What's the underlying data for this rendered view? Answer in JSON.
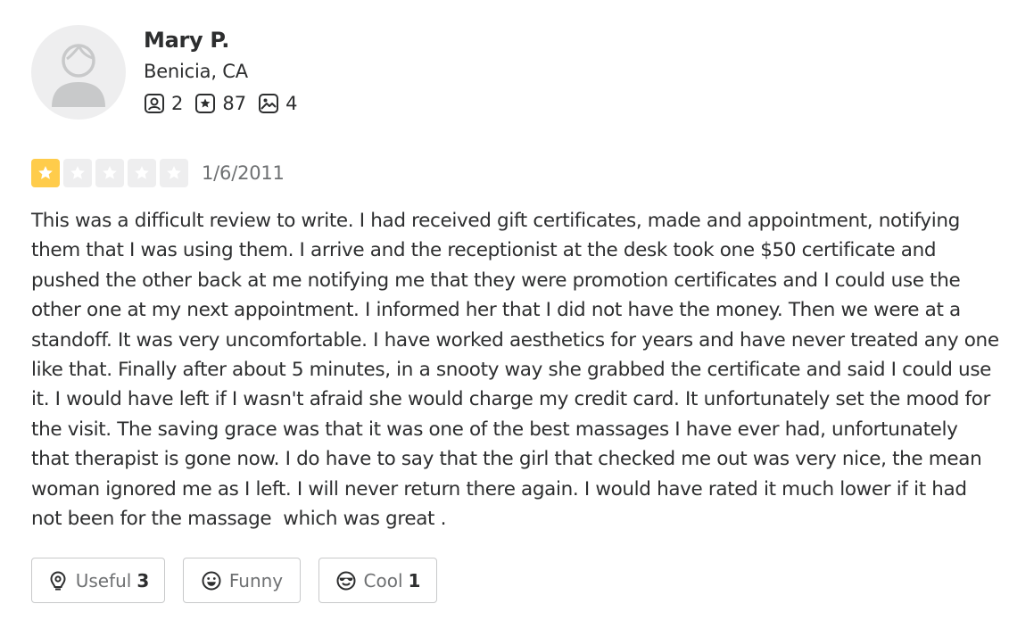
{
  "user": {
    "name": "Mary P.",
    "location": "Benicia, CA",
    "friends_count": "2",
    "reviews_count": "87",
    "photos_count": "4",
    "avatar_icon": "default-avatar-icon"
  },
  "review": {
    "rating": 1,
    "rating_max": 5,
    "date": "1/6/2011",
    "text": "This was a difficult review to write. I had received gift certificates, made and appointment, notifying them that I was using them. I arrive and the receptionist at the desk took one $50 certificate and pushed the other back at me notifying me that they were promotion certificates and I could use the other one at my next appointment. I informed her that I did not have the money. Then we were at a standoff. It was very uncomfortable. I have worked aesthetics for years and have never treated any one like that. Finally after about 5 minutes, in a snooty way she grabbed the certificate and said I could use it. I would have left if I wasn't afraid she would charge my credit card. It unfortunately set the mood for the visit. The saving grace was that it was one of the best massages I have ever had, unfortunately that therapist is gone now. I do have to say that the girl that checked me out was very nice, the mean woman ignored me as I left. I will never return there again. I would have rated it much lower if it had not been for the massage  which was great ."
  },
  "reactions": {
    "useful": {
      "label": "Useful",
      "count": "3",
      "icon": "lightbulb-icon"
    },
    "funny": {
      "label": "Funny",
      "count": "",
      "icon": "smile-icon"
    },
    "cool": {
      "label": "Cool",
      "count": "1",
      "icon": "sunglasses-icon"
    }
  },
  "colors": {
    "star_active": "#ffcc4b",
    "star_inactive": "#eeeeef",
    "text_primary": "#2d2e2f",
    "text_secondary": "#6e7072",
    "border": "#c8c9ca"
  }
}
